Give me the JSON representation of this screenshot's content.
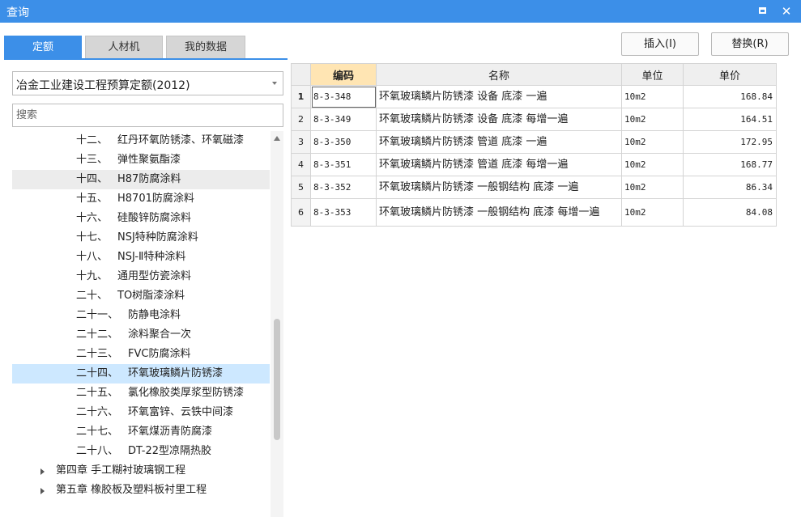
{
  "window": {
    "title": "查询",
    "restore_label": "restore-icon",
    "close_symbol": "✕"
  },
  "tabs": [
    {
      "label": "定额",
      "active": true
    },
    {
      "label": "人材机",
      "active": false
    },
    {
      "label": "我的数据",
      "active": false
    }
  ],
  "toolbar": {
    "insert_label": "插入(I)",
    "replace_label": "替换(R)"
  },
  "library": {
    "selected": "冶金工业建设工程预算定额(2012)"
  },
  "search": {
    "placeholder": "搜索",
    "value": ""
  },
  "tree": {
    "items": [
      {
        "num": "十二、",
        "label": "红丹环氧防锈漆、环氧磁漆",
        "state": "normal"
      },
      {
        "num": "十三、",
        "label": "弹性聚氨酯漆",
        "state": "normal"
      },
      {
        "num": "十四、",
        "label": "H87防腐涂料",
        "state": "hover"
      },
      {
        "num": "十五、",
        "label": "H8701防腐涂料",
        "state": "normal"
      },
      {
        "num": "十六、",
        "label": "硅酸锌防腐涂料",
        "state": "normal"
      },
      {
        "num": "十七、",
        "label": "NSJ特种防腐涂料",
        "state": "normal"
      },
      {
        "num": "十八、",
        "label": "NSJ-Ⅱ特种涂料",
        "state": "normal"
      },
      {
        "num": "十九、",
        "label": "通用型仿瓷涂料",
        "state": "normal"
      },
      {
        "num": "二十、",
        "label": "TO树脂漆涂料",
        "state": "normal"
      },
      {
        "num": "二十一、",
        "label": "防静电涂料",
        "state": "normal"
      },
      {
        "num": "二十二、",
        "label": "涂料聚合一次",
        "state": "normal"
      },
      {
        "num": "二十三、",
        "label": "FVC防腐涂料",
        "state": "normal"
      },
      {
        "num": "二十四、",
        "label": "环氧玻璃鳞片防锈漆",
        "state": "selected"
      },
      {
        "num": "二十五、",
        "label": "氯化橡胶类厚浆型防锈漆",
        "state": "normal"
      },
      {
        "num": "二十六、",
        "label": "环氧富锌、云铁中间漆",
        "state": "normal"
      },
      {
        "num": "二十七、",
        "label": "环氧煤沥青防腐漆",
        "state": "normal"
      },
      {
        "num": "二十八、",
        "label": "DT-22型凉隔热胶",
        "state": "normal"
      }
    ],
    "chapters": [
      {
        "label": "第四章 手工糊衬玻璃钢工程"
      },
      {
        "label": "第五章 橡胶板及塑料板衬里工程"
      }
    ]
  },
  "grid": {
    "headers": {
      "code": "编码",
      "name": "名称",
      "unit": "单位",
      "price": "单价"
    },
    "rows": [
      {
        "n": "1",
        "code": "8-3-348",
        "name": "环氧玻璃鳞片防锈漆 设备 底漆 一遍",
        "unit": "10m2",
        "price": "168.84"
      },
      {
        "n": "2",
        "code": "8-3-349",
        "name": "环氧玻璃鳞片防锈漆 设备 底漆 每增一遍",
        "unit": "10m2",
        "price": "164.51"
      },
      {
        "n": "3",
        "code": "8-3-350",
        "name": "环氧玻璃鳞片防锈漆 管道 底漆 一遍",
        "unit": "10m2",
        "price": "172.95"
      },
      {
        "n": "4",
        "code": "8-3-351",
        "name": "环氧玻璃鳞片防锈漆 管道 底漆 每增一遍",
        "unit": "10m2",
        "price": "168.77"
      },
      {
        "n": "5",
        "code": "8-3-352",
        "name": "环氧玻璃鳞片防锈漆 一般钢结构 底漆 一遍",
        "unit": "10m2",
        "price": "86.34"
      },
      {
        "n": "6",
        "code": "8-3-353",
        "name": "环氧玻璃鳞片防锈漆 一般钢结构 底漆 每增一遍",
        "unit": "10m2",
        "price": "84.08"
      }
    ]
  },
  "colors": {
    "accent": "#3c8fe8",
    "header_highlight": "#ffe5b3",
    "selection": "#cde8ff"
  }
}
